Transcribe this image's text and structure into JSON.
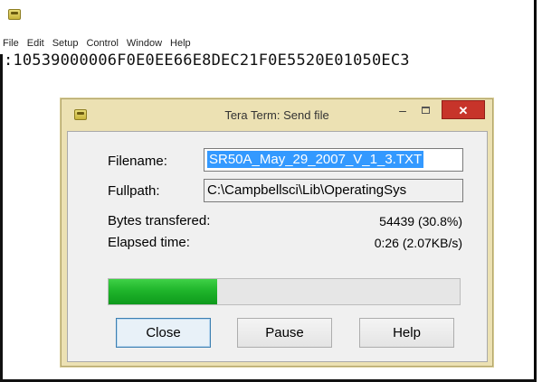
{
  "main_window": {
    "menu": [
      "File",
      "Edit",
      "Setup",
      "Control",
      "Window",
      "Help"
    ],
    "terminal_line": ":10539000006F0E0EE66E8DEC21F0E5520E01050EC3"
  },
  "dialog": {
    "title": "Tera Term: Send file",
    "controls": {
      "minimize": "–",
      "close": "✕"
    },
    "filename_label": "Filename:",
    "filename_value": "SR50A_May_29_2007_V_1_3.TXT",
    "fullpath_label": "Fullpath:",
    "fullpath_value": "C:\\Campbellsci\\Lib\\OperatingSys",
    "bytes_label": "Bytes transfered:",
    "bytes_value": "54439 (30.8%)",
    "elapsed_label": "Elapsed time:",
    "elapsed_value": "0:26 (2.07KB/s)",
    "progress_fraction": 0.308,
    "progress_color": "#1fb52b",
    "buttons": {
      "close": "Close",
      "pause": "Pause",
      "help": "Help"
    }
  },
  "icons": {
    "app": "tera-term-icon",
    "dialog": "tera-term-icon"
  },
  "colors": {
    "close_button": "#c7342a",
    "selection": "#3399ff",
    "dialog_frame": "#ece1b3"
  }
}
